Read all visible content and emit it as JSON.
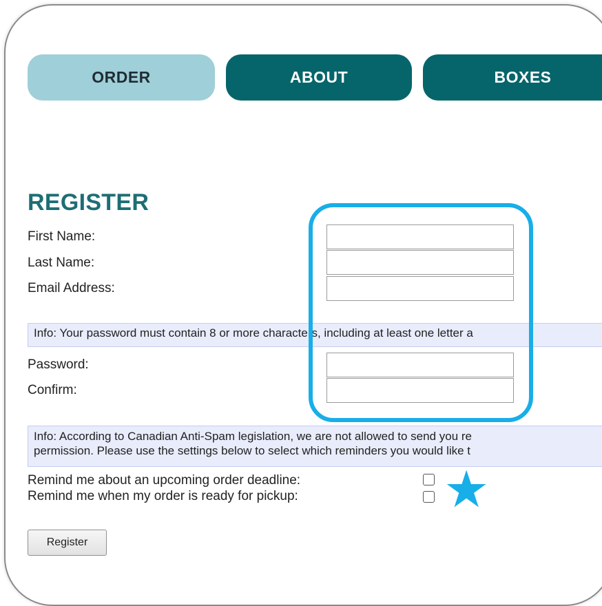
{
  "nav": {
    "tabs": [
      {
        "label": "ORDER",
        "active": true
      },
      {
        "label": "ABOUT",
        "active": false
      },
      {
        "label": "BOXES",
        "active": false
      }
    ]
  },
  "register": {
    "title": "REGISTER",
    "first_name_label": "First Name:",
    "last_name_label": "Last Name:",
    "email_label": "Email Address:",
    "password_info": "Info: Your password must contain 8 or more characters, including at least one letter a",
    "password_label": "Password:",
    "confirm_label": "Confirm:",
    "spam_info_line1": "Info: According to Canadian Anti-Spam legislation, we are not allowed to send you re",
    "spam_info_line2": "permission. Please use the settings below to select which reminders you would like t",
    "remind_deadline_label": "Remind me about an upcoming order deadline:",
    "remind_pickup_label": "Remind me when my order is ready for pickup:",
    "submit_label": "Register"
  },
  "annotations": {
    "highlight_color": "#18aee8",
    "star_icon": "star-icon"
  },
  "colors": {
    "tab_active": "#9fcfd8",
    "tab_inactive": "#05656a",
    "title": "#1d6e74"
  }
}
